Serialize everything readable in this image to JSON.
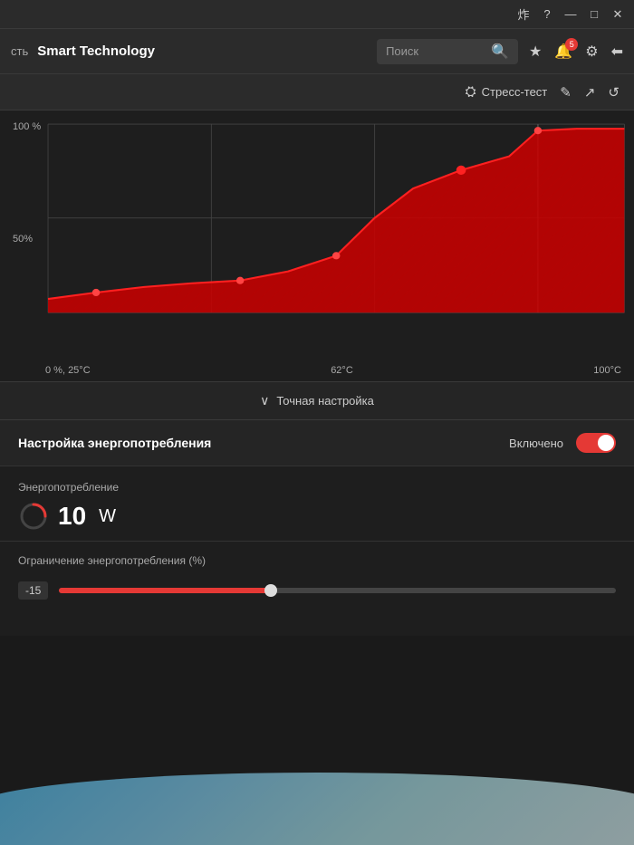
{
  "titlebar": {
    "icons": {
      "settings": "⚙",
      "help": "?",
      "minimize": "—",
      "maximize": "□",
      "close": "✕"
    }
  },
  "header": {
    "breadcrumb": "сть",
    "title": "Smart Technology",
    "search": {
      "placeholder": "Поиск"
    },
    "notification_count": "5",
    "icons": {
      "star": "★",
      "bell": "🔔",
      "gear": "⚙",
      "back": "⬅"
    }
  },
  "toolbar": {
    "stress_test_label": "Стресс-тест",
    "stress_icon": "⛭",
    "icons": {
      "edit": "✎",
      "export": "↗",
      "refresh": "↺"
    }
  },
  "chart": {
    "y_max_label": "100 %",
    "y_mid_label": "50%",
    "x_labels": {
      "left": "0 %, 25°C",
      "mid": "62°C",
      "right": "100°C"
    }
  },
  "fine_tune": {
    "chevron": "∨",
    "label": "Точная настройка"
  },
  "power_settings": {
    "label": "Настройка энергопотребления",
    "value": "Включено",
    "toggle_on": true
  },
  "consumption": {
    "label": "Энергопотребление",
    "value": "10",
    "unit": "W"
  },
  "limit": {
    "label": "Ограничение энергопотребления (%)",
    "slider_value": "-15",
    "slider_percent": 38
  }
}
